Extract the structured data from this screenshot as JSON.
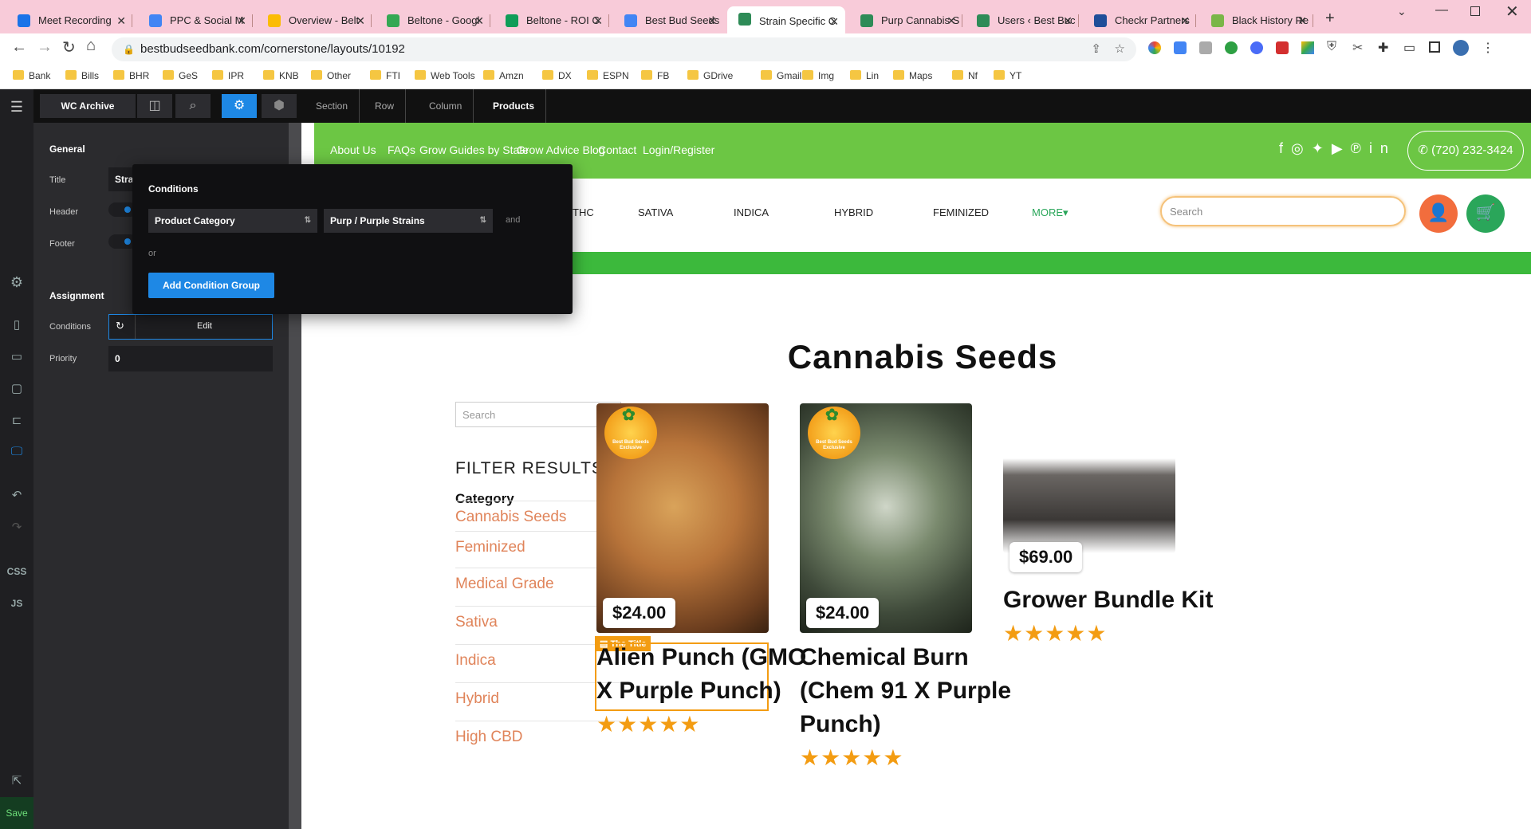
{
  "tabs": [
    {
      "label": "Meet Recording",
      "color": "#1a73e8"
    },
    {
      "label": "PPC & Social M",
      "color": "#4285f4"
    },
    {
      "label": "Overview - Belt",
      "color": "#fbbc04"
    },
    {
      "label": "Beltone - Googl",
      "color": "#34a853"
    },
    {
      "label": "Beltone - ROI C",
      "color": "#0f9d58"
    },
    {
      "label": "Best Bud Seeds",
      "color": "#4285f4"
    },
    {
      "label": "Strain Specific C",
      "color": "#2e8b57"
    },
    {
      "label": "Purp Cannabis S",
      "color": "#2e8b57"
    },
    {
      "label": "Users ‹ Best Buc",
      "color": "#2e8b57"
    },
    {
      "label": "Checkr Partners",
      "color": "#1f4e99"
    },
    {
      "label": "Black History Re",
      "color": "#7ab648"
    }
  ],
  "address": {
    "url": "bestbudseedbank.com/cornerstone/layouts/10192"
  },
  "bookmarks": [
    "Bank",
    "Bills",
    "BHR",
    "GeS",
    "IPR",
    "KNB",
    "Other",
    "FTI",
    "Web Tools",
    "Amzn",
    "DX",
    "ESPN",
    "FB",
    "GDrive",
    "Gmail",
    "Img",
    "Lin",
    "Maps",
    "Nf",
    "YT"
  ],
  "builder": {
    "layout_name": "WC Archive",
    "breadcrumbs": [
      "Section 1",
      "Row 2",
      "Column 2",
      "Products"
    ],
    "rail": {
      "css": "CSS",
      "js": "JS",
      "save": "Save"
    },
    "panel": {
      "general": "General",
      "title_label": "Title",
      "title_value": "Strai",
      "header_label": "Header",
      "footer_label": "Footer",
      "assignment": "Assignment",
      "conditions_label": "Conditions",
      "edit": "Edit",
      "priority_label": "Priority",
      "priority_value": "0"
    },
    "popup": {
      "heading": "Conditions",
      "condition_type": "Product Category",
      "condition_value": "Purp / Purple Strains",
      "and": "and",
      "or": "or",
      "add_group": "Add Condition Group"
    }
  },
  "site": {
    "topnav": [
      "About Us",
      "FAQs",
      "Grow Guides by State",
      "Grow Advice Blog",
      "Contact",
      "Login/Register"
    ],
    "phone": "(720) 232-3424",
    "mainnav": [
      "THC",
      "SATIVA",
      "INDICA",
      "HYBRID",
      "FEMINIZED",
      "MORE"
    ],
    "search_placeholder": "Search",
    "page_title": "Cannabis Seeds",
    "sidebar_search_placeholder": "Search",
    "filter_heading": "FILTER RESULTS",
    "category_heading": "Category",
    "categories": [
      "Cannabis Seeds",
      "Feminized",
      "Medical Grade",
      "Sativa",
      "Indica",
      "Hybrid",
      "High CBD"
    ],
    "badge_text": "Best Bud Seeds Exclusive",
    "element_tag": "The Title",
    "products": [
      {
        "price": "$24.00",
        "title_lines": [
          "Alien Punch (GMO",
          "X Purple Punch)"
        ],
        "rating": 5
      },
      {
        "price": "$24.00",
        "title_lines": [
          "Chemical Burn",
          "(Chem 91 X Purple",
          "Punch)"
        ],
        "rating": 5
      },
      {
        "price": "$69.00",
        "title_lines": [
          "Grower Bundle Kit"
        ],
        "rating": 5
      }
    ]
  },
  "colors": {
    "accent_green": "#6cc644",
    "orange": "#e0845a",
    "builder_blue": "#1e88e5"
  }
}
